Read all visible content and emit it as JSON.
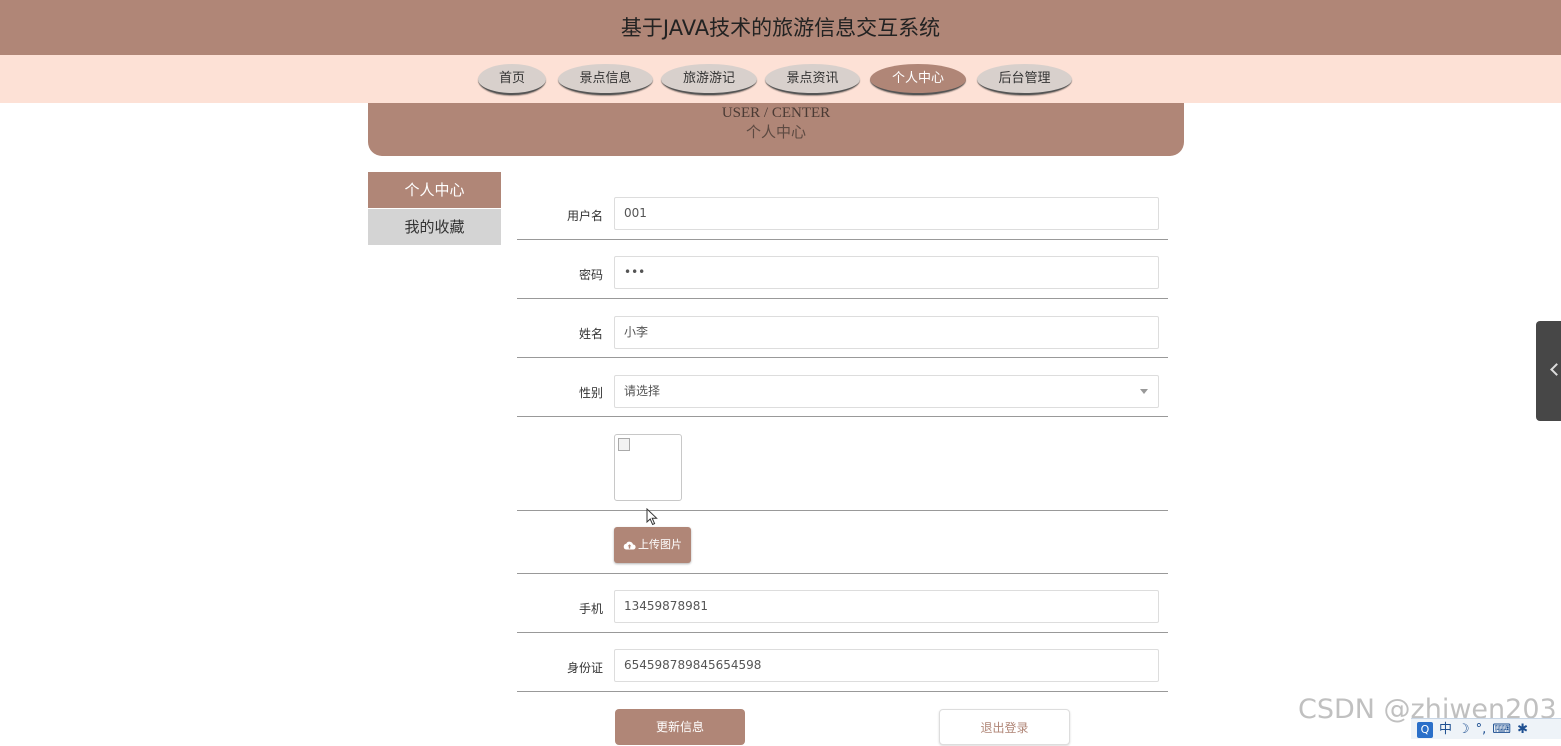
{
  "header": {
    "title": "基于JAVA技术的旅游信息交互系统"
  },
  "nav": {
    "items": [
      {
        "label": "首页"
      },
      {
        "label": "景点信息"
      },
      {
        "label": "旅游游记"
      },
      {
        "label": "景点资讯"
      },
      {
        "label": "个人中心"
      },
      {
        "label": "后台管理"
      }
    ],
    "active": "个人中心"
  },
  "banner": {
    "title_en": "USER / CENTER",
    "title_cn": "个人中心"
  },
  "sidebar": {
    "items": [
      {
        "label": "个人中心"
      },
      {
        "label": "我的收藏"
      }
    ]
  },
  "form": {
    "username": {
      "label": "用户名",
      "value": "001"
    },
    "password": {
      "label": "密码",
      "value": "•••"
    },
    "name": {
      "label": "姓名",
      "value": "小李"
    },
    "gender": {
      "label": "性别",
      "placeholder": "请选择"
    },
    "upload_button": "上传图片",
    "phone": {
      "label": "手机",
      "value": "13459878981"
    },
    "id_card": {
      "label": "身份证",
      "value": "654598789845654598"
    },
    "update_button": "更新信息",
    "logout_button": "退出登录"
  },
  "colors": {
    "accent": "#b08677",
    "nav_bg": "#fde1d6",
    "sidebar_inactive": "#d4d4d4"
  },
  "overlay": {
    "watermark": "CSDN @zhiwen203",
    "taskbar": {
      "ime_label": "中",
      "logo_letter": "Q"
    }
  }
}
